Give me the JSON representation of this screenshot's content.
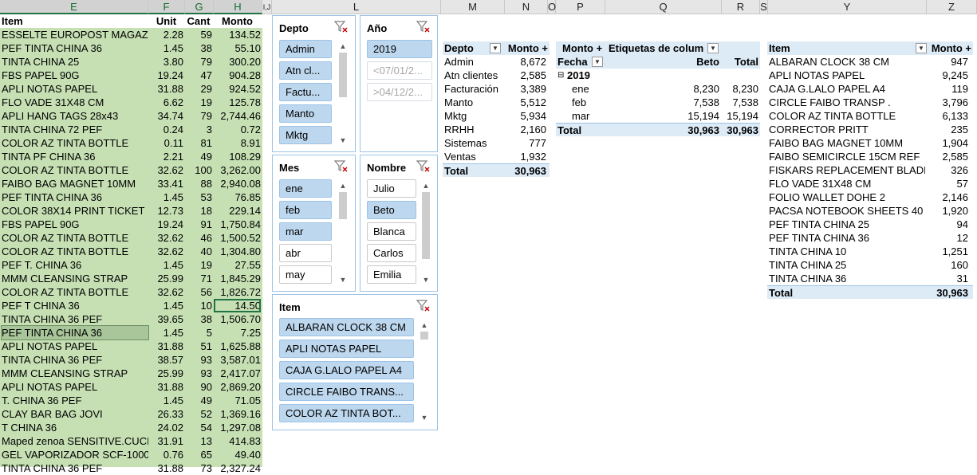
{
  "columns": [
    "E",
    "F",
    "G",
    "H",
    "I,J",
    "L",
    "M",
    "N",
    "O",
    "P",
    "Q",
    "R",
    "S",
    "Y",
    "Z"
  ],
  "left_table": {
    "headers": {
      "item": "Item",
      "unit": "Unit",
      "cant": "Cant",
      "monto": "Monto"
    },
    "rows": [
      [
        "ESSELTE EUROPOST MAGAZ",
        "2.28",
        "59",
        "134.52"
      ],
      [
        "PEF TINTA CHINA 36",
        "1.45",
        "38",
        "55.10"
      ],
      [
        "TINTA CHINA 25",
        "3.80",
        "79",
        "300.20"
      ],
      [
        "FBS PAPEL 90G",
        "19.24",
        "47",
        "904.28"
      ],
      [
        "APLI NOTAS PAPEL",
        "31.88",
        "29",
        "924.52"
      ],
      [
        "FLO VADE 31X48 CM",
        "6.62",
        "19",
        "125.78"
      ],
      [
        "APLI HANG TAGS 28x43",
        "34.74",
        "79",
        "2,744.46"
      ],
      [
        "TINTA CHINA 72 PEF",
        "0.24",
        "3",
        "0.72"
      ],
      [
        "COLOR AZ TINTA BOTTLE",
        "0.11",
        "81",
        "8.91"
      ],
      [
        "TINTA PF CHINA 36",
        "2.21",
        "49",
        "108.29"
      ],
      [
        "COLOR AZ TINTA BOTTLE",
        "32.62",
        "100",
        "3,262.00"
      ],
      [
        "FAIBO BAG MAGNET 10MM",
        "33.41",
        "88",
        "2,940.08"
      ],
      [
        "PEF TINTA CHINA 36",
        "1.45",
        "53",
        "76.85"
      ],
      [
        "COLOR 38X14 PRINT TICKET",
        "12.73",
        "18",
        "229.14"
      ],
      [
        "FBS PAPEL 90G",
        "19.24",
        "91",
        "1,750.84"
      ],
      [
        "COLOR AZ TINTA BOTTLE",
        "32.62",
        "46",
        "1,500.52"
      ],
      [
        "COLOR AZ TINTA BOTTLE",
        "32.62",
        "40",
        "1,304.80"
      ],
      [
        "PEF T. CHINA 36",
        "1.45",
        "19",
        "27.55"
      ],
      [
        "MMM CLEANSING STRAP",
        "25.99",
        "71",
        "1,845.29"
      ],
      [
        "COLOR AZ TINTA BOTTLE",
        "32.62",
        "56",
        "1,826.72"
      ],
      [
        "PEF T CHINA 36",
        "1.45",
        "10",
        "14.50"
      ],
      [
        "TINTA CHINA 36 PEF",
        "39.65",
        "38",
        "1,506.70"
      ],
      [
        "PEF TINTA CHINA 36",
        "1.45",
        "5",
        "7.25"
      ],
      [
        "APLI NOTAS PAPEL",
        "31.88",
        "51",
        "1,625.88"
      ],
      [
        "TINTA CHINA 36 PEF",
        "38.57",
        "93",
        "3,587.01"
      ],
      [
        "MMM CLEANSING STRAP",
        "25.99",
        "93",
        "2,417.07"
      ],
      [
        "APLI NOTAS PAPEL",
        "31.88",
        "90",
        "2,869.20"
      ],
      [
        "T. CHINA 36 PEF",
        "1.45",
        "49",
        "71.05"
      ],
      [
        "CLAY BAR BAG JOVI",
        "26.33",
        "52",
        "1,369.16"
      ],
      [
        "T CHINA 36",
        "24.02",
        "54",
        "1,297.08"
      ],
      [
        "Maped zenoa SENSITIVE.CUCH",
        "31.91",
        "13",
        "414.83"
      ],
      [
        "GEL VAPORIZADOR SCF-1000",
        "0.76",
        "65",
        "49.40"
      ],
      [
        "TINTA CHINA 36 PEF",
        "31.88",
        "73",
        "2,327.24"
      ]
    ]
  },
  "slicers": {
    "depto": {
      "title": "Depto",
      "items": [
        "Admin",
        "Atn cl...",
        "Factu...",
        "Manto",
        "Mktg"
      ]
    },
    "anio": {
      "title": "Año",
      "items": [
        "2019",
        "<07/01/2...",
        ">04/12/2..."
      ]
    },
    "mes": {
      "title": "Mes",
      "items": [
        "ene",
        "feb",
        "mar",
        "abr",
        "may"
      ]
    },
    "nombre": {
      "title": "Nombre",
      "items": [
        "Julio",
        "Beto",
        "Blanca",
        "Carlos",
        "Emilia"
      ]
    },
    "item": {
      "title": "Item",
      "items": [
        "ALBARAN CLOCK 38 CM",
        "APLI NOTAS PAPEL",
        "CAJA G.LALO PAPEL A4",
        "CIRCLE FAIBO TRANS...",
        "COLOR AZ TINTA BOT..."
      ]
    }
  },
  "pivot_depto": {
    "head_label": "Depto",
    "head_value": "Monto +",
    "rows": [
      [
        "Admin",
        "8,672"
      ],
      [
        "Atn clientes",
        "2,585"
      ],
      [
        "Facturación",
        "3,389"
      ],
      [
        "Manto",
        "5,512"
      ],
      [
        "Mktg",
        "5,934"
      ],
      [
        "RRHH",
        "2,160"
      ],
      [
        "Sistemas",
        "777"
      ],
      [
        "Ventas",
        "1,932"
      ]
    ],
    "total_label": "Total",
    "total_value": "30,963"
  },
  "pivot_fecha": {
    "h1_a": "Monto +",
    "h1_b": "Etiquetas de colum",
    "h2_a": "Fecha",
    "h2_b": "Beto",
    "h2_c": "Total",
    "year": "2019",
    "rows": [
      [
        "ene",
        "8,230",
        "8,230"
      ],
      [
        "feb",
        "7,538",
        "7,538"
      ],
      [
        "mar",
        "15,194",
        "15,194"
      ]
    ],
    "total_label": "Total",
    "total_b": "30,963",
    "total_c": "30,963"
  },
  "pivot_item": {
    "head_label": "Item",
    "head_value": "Monto +",
    "rows": [
      [
        "ALBARAN CLOCK 38 CM",
        "947"
      ],
      [
        "APLI NOTAS PAPEL",
        "9,245"
      ],
      [
        "CAJA G.LALO PAPEL A4",
        "119"
      ],
      [
        "CIRCLE FAIBO TRANSP .",
        "3,796"
      ],
      [
        "COLOR AZ TINTA BOTTLE",
        "6,133"
      ],
      [
        "CORRECTOR PRITT",
        "235"
      ],
      [
        "FAIBO BAG MAGNET 10MM",
        "1,904"
      ],
      [
        "FAIBO SEMICIRCLE 15CM REF",
        "2,585"
      ],
      [
        "FISKARS REPLACEMENT BLADE",
        "326"
      ],
      [
        "FLO VADE 31X48 CM",
        "57"
      ],
      [
        "FOLIO WALLET DOHE 2",
        "2,146"
      ],
      [
        "PACSA NOTEBOOK SHEETS 40",
        "1,920"
      ],
      [
        "PEF TINTA CHINA 25",
        "94"
      ],
      [
        "PEF TINTA CHINA 36",
        "12"
      ],
      [
        "TINTA CHINA 10",
        "1,251"
      ],
      [
        "TINTA CHINA 25",
        "160"
      ],
      [
        "TINTA CHINA 36",
        "31"
      ]
    ],
    "total_label": "Total",
    "total_value": "30,963"
  }
}
